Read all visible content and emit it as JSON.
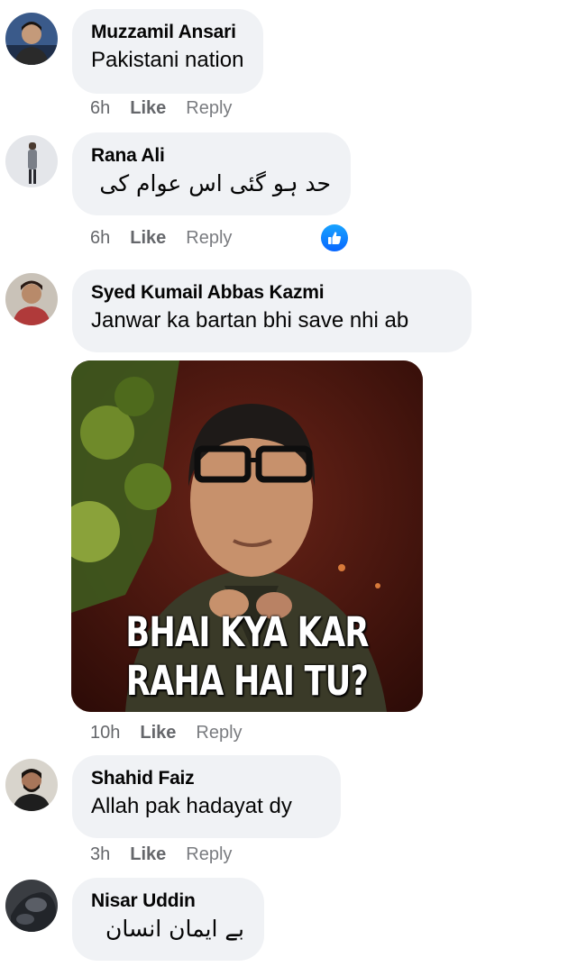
{
  "comments": [
    {
      "author": "Muzzamil Ansari",
      "text": "Pakistani nation",
      "time": "6h",
      "like": "Like",
      "reply": "Reply"
    },
    {
      "author": "Rana Ali",
      "text": "حد ہو گئی اس عوام کی",
      "time": "6h",
      "like": "Like",
      "reply": "Reply",
      "reaction": "like-reaction-icon"
    },
    {
      "author": "Syed Kumail Abbas Kazmi",
      "text": "Janwar ka bartan bhi save nhi ab",
      "time": "10h",
      "like": "Like",
      "reply": "Reply",
      "attachment": {
        "caption_line1": "BHAI KYA KAR",
        "caption_line2": "RAHA HAI TU?"
      }
    },
    {
      "author": "Shahid Faiz",
      "text": "Allah pak hadayat dy",
      "time": "3h",
      "like": "Like",
      "reply": "Reply"
    },
    {
      "author": "Nisar Uddin",
      "text": "بے ایمان انسان"
    }
  ],
  "colors": {
    "bubble": "#f0f2f5",
    "meta_text": "#65676b",
    "reaction_blue": "#0866ff"
  }
}
